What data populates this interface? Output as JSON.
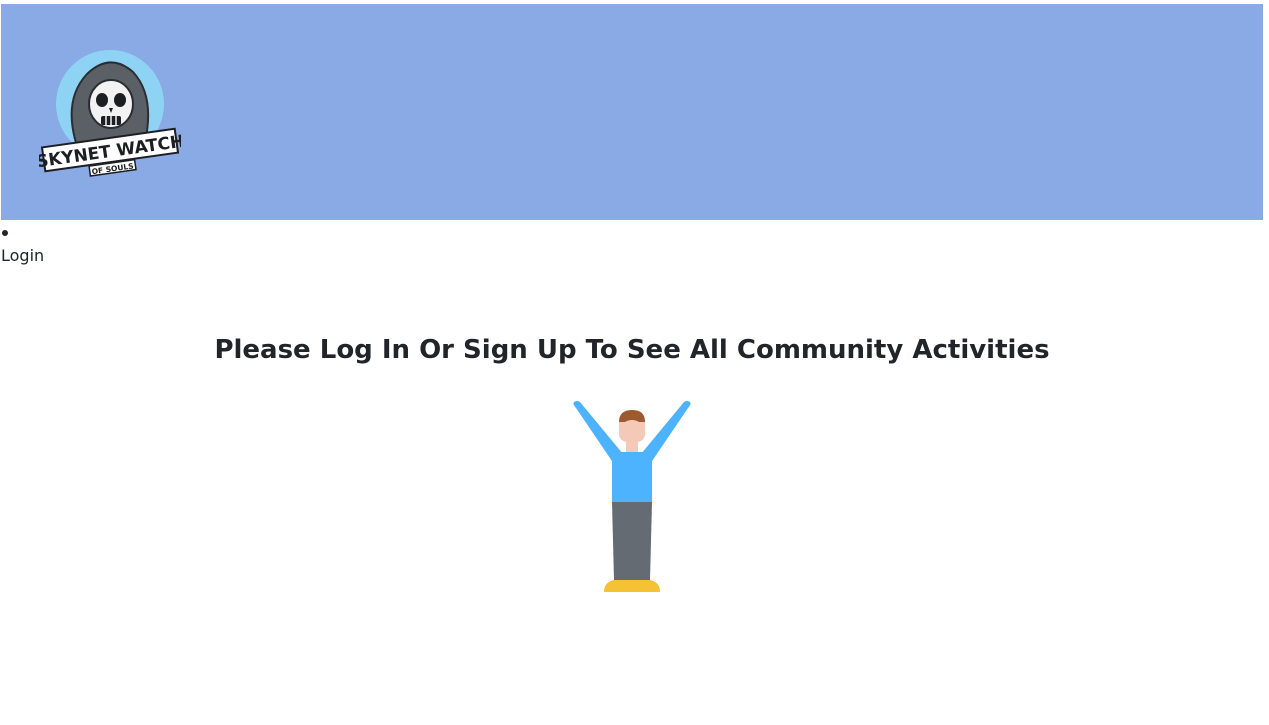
{
  "header": {
    "logo": {
      "icon": "skull-reaper-logo-icon",
      "title_text": "SKYNET WATCH",
      "subtitle_text": "OF SOULS"
    },
    "background_color": "#8aaae5"
  },
  "nav": {
    "items": [
      {
        "label": "Login"
      }
    ]
  },
  "main": {
    "headline": "Please Log In Or Sign Up To See All Community Activities",
    "illustration": {
      "icon": "person-arms-raised-icon",
      "colors": {
        "shirt": "#4db3ff",
        "pants": "#646b73",
        "shoes": "#f5c234",
        "skin": "#f5c9b8",
        "hair": "#9c5a2e"
      }
    }
  }
}
